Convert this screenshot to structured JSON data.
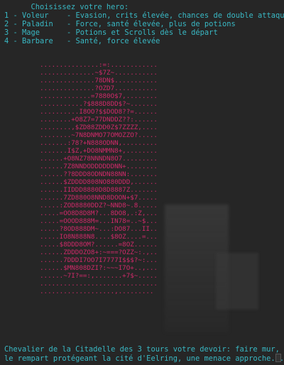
{
  "menu": {
    "prompt": "      Choisissez votre hero:",
    "options": [
      {
        "key": "1 - Voleur",
        "desc": "- Evasion, crits élevée, chances de double attaque"
      },
      {
        "key": "2 - Paladin",
        "desc": "- Force, santé élevée, plus de potions"
      },
      {
        "key": "3 - Mage",
        "desc": "- Potions et Scrolls dès le départ"
      },
      {
        "key": "4 - Barbare",
        "desc": "- Santé, force élevée"
      }
    ]
  },
  "art": [
    "...............:=:............",
    "..............~$7Z~...........",
    "..............78DN$...........",
    "..............?OZD7...........",
    ".............=7880O$7,........",
    "...........?$888D8DD$?~.......",
    "..........I8OO?$$DOD8??=......",
    "........+O8Z7=77DNDDZ??:......",
    "........,$ZD88ZDD0Z$7ZZZZ,....",
    "........~7N8DNMO77OMOZZO?.....",
    ".......:78?+N888ODNN,.........",
    ".......I$Z,+DO8NMMN8+,........",
    "......+O8NZ78NNNDN8O7.........",
    "......7Z8NNDODDDDDDNN+........",
    "......??8DDD8ODNDN88NN:.......",
    "......$ZDDDD808NO880DDD,......",
    "......IIDDD8880D8D8887Z.......",
    "......7ZD880O8NND8DOON+$7.....",
    ".....:ZOD8880DDZ?~NND8~.8.....",
    ".....=OO8D8D8M?...8DO8,.:Z,...",
    ".....=OOOD888M=...IN78=..~$...",
    ".....?8OD888DM~...:DO87...II..",
    ".....IO8N888N8....$8OZ....=...",
    ".....$8DDD8OM?......=8OZ......",
    "......ZDDDOZO8+:~===?OZZ~:.,..",
    "......7DDDI7OO7I7777I$$$?~:...",
    "......$MN808DZI?:~~~I7O+..,...",
    "......~7I?==:,.......+7$~.....",
    "..............................",
    "...................,......... "
  ],
  "story": {
    "line1": "Chevalier de la Citadelle des 3 tours votre devoir: faire mur,",
    "line2": "le rempart protégeant la cité d'Eelring, une menace approche..."
  }
}
